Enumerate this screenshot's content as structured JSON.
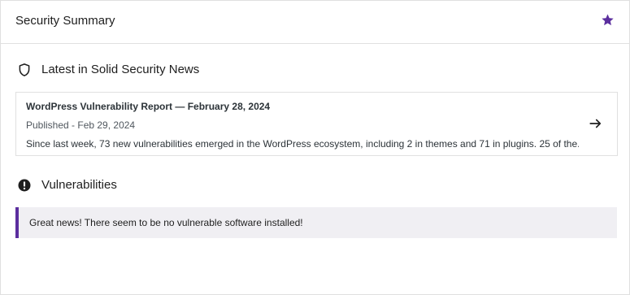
{
  "header": {
    "title": "Security Summary",
    "star_icon": "star-icon"
  },
  "news": {
    "heading": "Latest in Solid Security News",
    "heading_icon": "shield-icon",
    "item": {
      "title": "WordPress Vulnerability Report — February 28, 2024",
      "date": "Published - Feb 29, 2024",
      "excerpt": "Since last week, 73 new vulnerabilities emerged in the WordPress ecosystem, including 2 in themes and 71 in plugins. 25 of the...",
      "arrow_icon": "arrow-right-icon"
    }
  },
  "vulnerabilities": {
    "heading": "Vulnerabilities",
    "heading_icon": "exclamation-circle-icon",
    "notice": "Great news! There seem to be no vulnerable software installed!"
  },
  "colors": {
    "accent": "#5b2e9e",
    "notice_bg": "#f0eff3",
    "border": "#e0e0e0"
  }
}
